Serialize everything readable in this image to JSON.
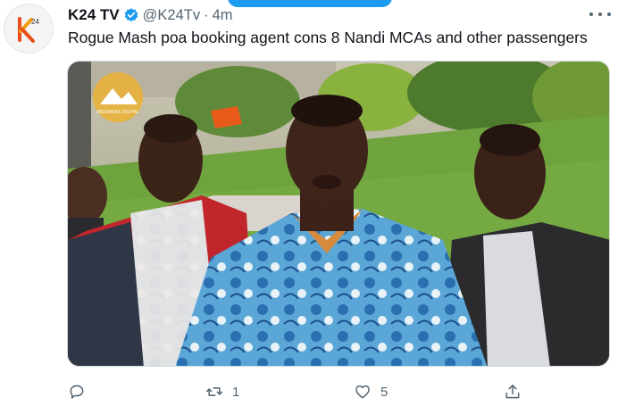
{
  "tweet": {
    "display_name": "K24 TV",
    "handle": "@K24Tv",
    "separator": "·",
    "time": "4m",
    "text": "Rogue Mash poa booking agent cons 8 Nandi MCAs and other passengers",
    "verified_color": "#1d9bf0",
    "avatar_logo_text": "K24",
    "media_watermark_text": "MEDIAMAX DIGITAL"
  },
  "actions": {
    "reply_icon": "reply-icon",
    "retweet_icon": "retweet-icon",
    "retweet_count": "1",
    "like_icon": "heart-icon",
    "like_count": "5",
    "share_icon": "share-icon"
  },
  "colors": {
    "accent": "#1d9bf0",
    "secondary_text": "#536471",
    "primary_text": "#0f1419"
  }
}
